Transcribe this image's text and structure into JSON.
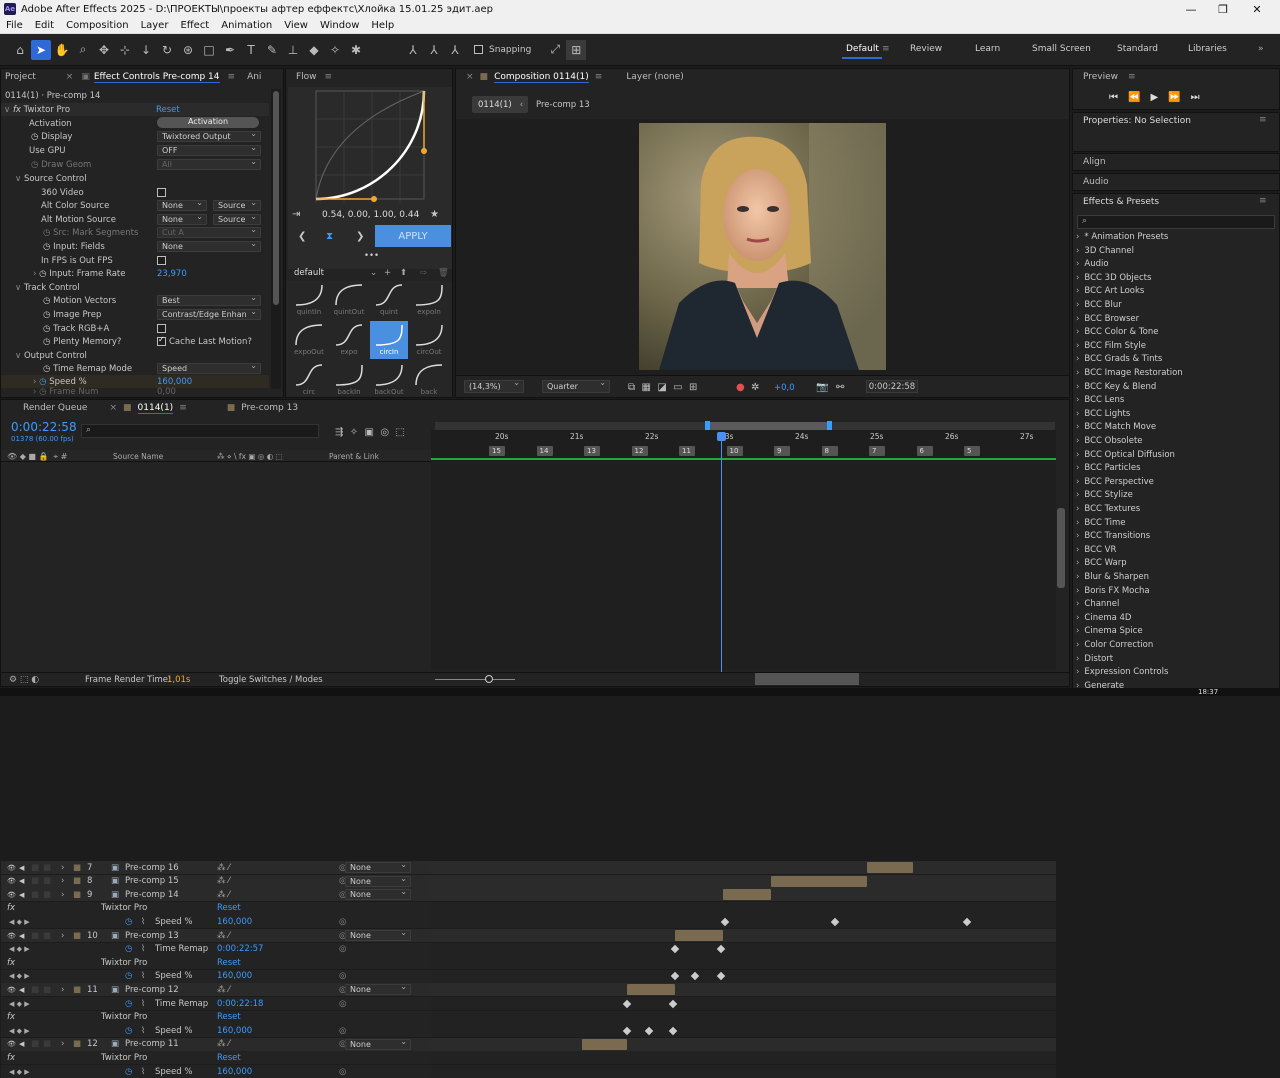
{
  "window": {
    "title": "Adobe After Effects 2025 - D:\\ПРОЕКТЫ\\проекты афтер еффектс\\Хлойка 15.01.25 эдит.aep",
    "app_badge": "Ae",
    "ctrl_min": "—",
    "ctrl_max": "❐",
    "ctrl_close": "✕"
  },
  "menu": [
    "File",
    "Edit",
    "Composition",
    "Layer",
    "Effect",
    "Animation",
    "View",
    "Window",
    "Help"
  ],
  "toolbar": {
    "snapping": "Snapping"
  },
  "workspaces": [
    "Default",
    "Review",
    "Learn",
    "Small Screen",
    "Standard",
    "Libraries"
  ],
  "project_panel": {
    "tab_project": "Project",
    "tab_effect_controls": "Effect Controls Pre-comp 14",
    "tab_more": "Ani",
    "comp_label": "0114(1) · Pre-comp 14"
  },
  "effect_controls": {
    "effect_name": "Twixtor Pro",
    "reset": "Reset",
    "rows": [
      {
        "label": "Activation",
        "value": "Activation"
      },
      {
        "label": "Display",
        "value": "Twixtored Output"
      },
      {
        "label": "Use GPU",
        "value": "OFF"
      },
      {
        "label": "Draw Geom",
        "value": "All"
      },
      {
        "label": "Source Control",
        "value": ""
      },
      {
        "label": "360 Video",
        "value": ""
      },
      {
        "label": "Alt Color Source",
        "value": "None",
        "value2": "Source"
      },
      {
        "label": "Alt Motion Source",
        "value": "None",
        "value2": "Source"
      },
      {
        "label": "Src: Mark Segments",
        "value": "Cut A"
      },
      {
        "label": "Input: Fields",
        "value": "None"
      },
      {
        "label": "In FPS is Out FPS",
        "value": ""
      },
      {
        "label": "Input: Frame Rate",
        "value": "23,970"
      },
      {
        "label": "Track Control",
        "value": ""
      },
      {
        "label": "Motion Vectors",
        "value": "Best"
      },
      {
        "label": "Image Prep",
        "value": "Contrast/Edge Enhan"
      },
      {
        "label": "Track RGB+A",
        "value": ""
      },
      {
        "label": "Plenty Memory?",
        "value": "Cache Last Motion?"
      },
      {
        "label": "Output Control",
        "value": ""
      },
      {
        "label": "Time Remap Mode",
        "value": "Speed"
      },
      {
        "label": "Speed %",
        "value": "160,000"
      },
      {
        "label": "Frame Num",
        "value": "0,00"
      }
    ]
  },
  "flow": {
    "title": "Flow",
    "bezier": "0.54, 0.00, 1.00, 0.44",
    "apply": "APPLY",
    "preset_set": "default",
    "more": "•••",
    "presets_row0": [
      "quintIn",
      "quintOut",
      "quint",
      "expoIn"
    ],
    "presets_row1": [
      "expoOut",
      "expo",
      "circIn",
      "circOut"
    ],
    "presets_row2": [
      "circ",
      "backIn",
      "backOut",
      "back"
    ]
  },
  "composition": {
    "tab": "Composition 0114(1)",
    "layer_tab": "Layer (none)",
    "crumb1": "0114(1)",
    "crumb2": "Pre-comp 13",
    "zoom": "(14,3%)",
    "resolution": "Quarter",
    "exposure": "+0,0",
    "timecode": "0:00:22:58"
  },
  "preview": {
    "title": "Preview"
  },
  "properties": {
    "title": "Properties: No Selection"
  },
  "right_sections": {
    "align": "Align",
    "audio": "Audio",
    "effects_presets": "Effects & Presets"
  },
  "effects_list": [
    "* Animation Presets",
    "3D Channel",
    "Audio",
    "BCC 3D Objects",
    "BCC Art Looks",
    "BCC Blur",
    "BCC Browser",
    "BCC Color & Tone",
    "BCC Film Style",
    "BCC Grads & Tints",
    "BCC Image Restoration",
    "BCC Key & Blend",
    "BCC Lens",
    "BCC Lights",
    "BCC Match Move",
    "BCC Obsolete",
    "BCC Optical Diffusion",
    "BCC Particles",
    "BCC Perspective",
    "BCC Stylize",
    "BCC Textures",
    "BCC Time",
    "BCC Transitions",
    "BCC VR",
    "BCC Warp",
    "Blur & Sharpen",
    "Boris FX Mocha",
    "Channel",
    "Cinema 4D",
    "Cinema Spice",
    "Color Correction",
    "Distort",
    "Expression Controls",
    "Generate"
  ],
  "timeline": {
    "tabs": [
      "Render Queue",
      "0114(1)",
      "Pre-comp 13"
    ],
    "timecode": "0:00:22:58",
    "frame_info": "01378 (60.00 fps)",
    "col_source": "Source Name",
    "col_parent": "Parent & Link",
    "ruler": [
      "20s",
      "21s",
      "22s",
      "23s",
      "24s",
      "25s",
      "26s",
      "27s"
    ],
    "markers": [
      "15",
      "14",
      "13",
      "12",
      "11",
      "10",
      "9",
      "8",
      "7",
      "6",
      "5"
    ],
    "frame_render_label": "Frame Render Time:",
    "frame_render_value": "1,01s",
    "toggle": "Toggle Switches / Modes",
    "rows": [
      {
        "type": "layer",
        "num": "7",
        "name": "Pre-comp 16",
        "parent": "None"
      },
      {
        "type": "layer",
        "num": "8",
        "name": "Pre-comp 15",
        "parent": "None"
      },
      {
        "type": "layer",
        "num": "9",
        "name": "Pre-comp 14",
        "parent": "None"
      },
      {
        "type": "effect",
        "name": "Twixtor Pro",
        "value": "Reset"
      },
      {
        "type": "prop",
        "name": "Speed %",
        "value": "160,000"
      },
      {
        "type": "layer",
        "num": "10",
        "name": "Pre-comp 13",
        "parent": "None"
      },
      {
        "type": "prop",
        "name": "Time Remap",
        "value": "0:00:22:57"
      },
      {
        "type": "effect",
        "name": "Twixtor Pro",
        "value": "Reset"
      },
      {
        "type": "prop",
        "name": "Speed %",
        "value": "160,000"
      },
      {
        "type": "layer",
        "num": "11",
        "name": "Pre-comp 12",
        "parent": "None"
      },
      {
        "type": "prop",
        "name": "Time Remap",
        "value": "0:00:22:18"
      },
      {
        "type": "effect",
        "name": "Twixtor Pro",
        "value": "Reset"
      },
      {
        "type": "prop",
        "name": "Speed %",
        "value": "160,000"
      },
      {
        "type": "layer",
        "num": "12",
        "name": "Pre-comp 11",
        "parent": "None"
      },
      {
        "type": "effect",
        "name": "Twixtor Pro",
        "value": "Reset"
      },
      {
        "type": "prop",
        "name": "Speed %",
        "value": "160,000"
      }
    ]
  },
  "taskbar": {
    "clock": "18:37"
  },
  "colors": {
    "accent": "#2d6ad6",
    "link": "#3b9bff",
    "playhead": "#4d8ff0",
    "layer_bar": "#7a6a50",
    "workarea": "#26a641"
  },
  "icons": [
    "ae-app-icon",
    "home-icon",
    "selection-tool-icon",
    "hand-tool-icon",
    "zoom-tool-icon",
    "rotate-tool-icon",
    "rect-tool-icon",
    "pen-tool-icon",
    "type-tool-icon",
    "brush-tool-icon",
    "eraser-tool-icon",
    "puppet-tool-icon",
    "fx-icon",
    "stopwatch-icon",
    "keyframe-icon",
    "search-icon",
    "menu-icon",
    "star-icon",
    "camera-icon",
    "play-icon"
  ]
}
